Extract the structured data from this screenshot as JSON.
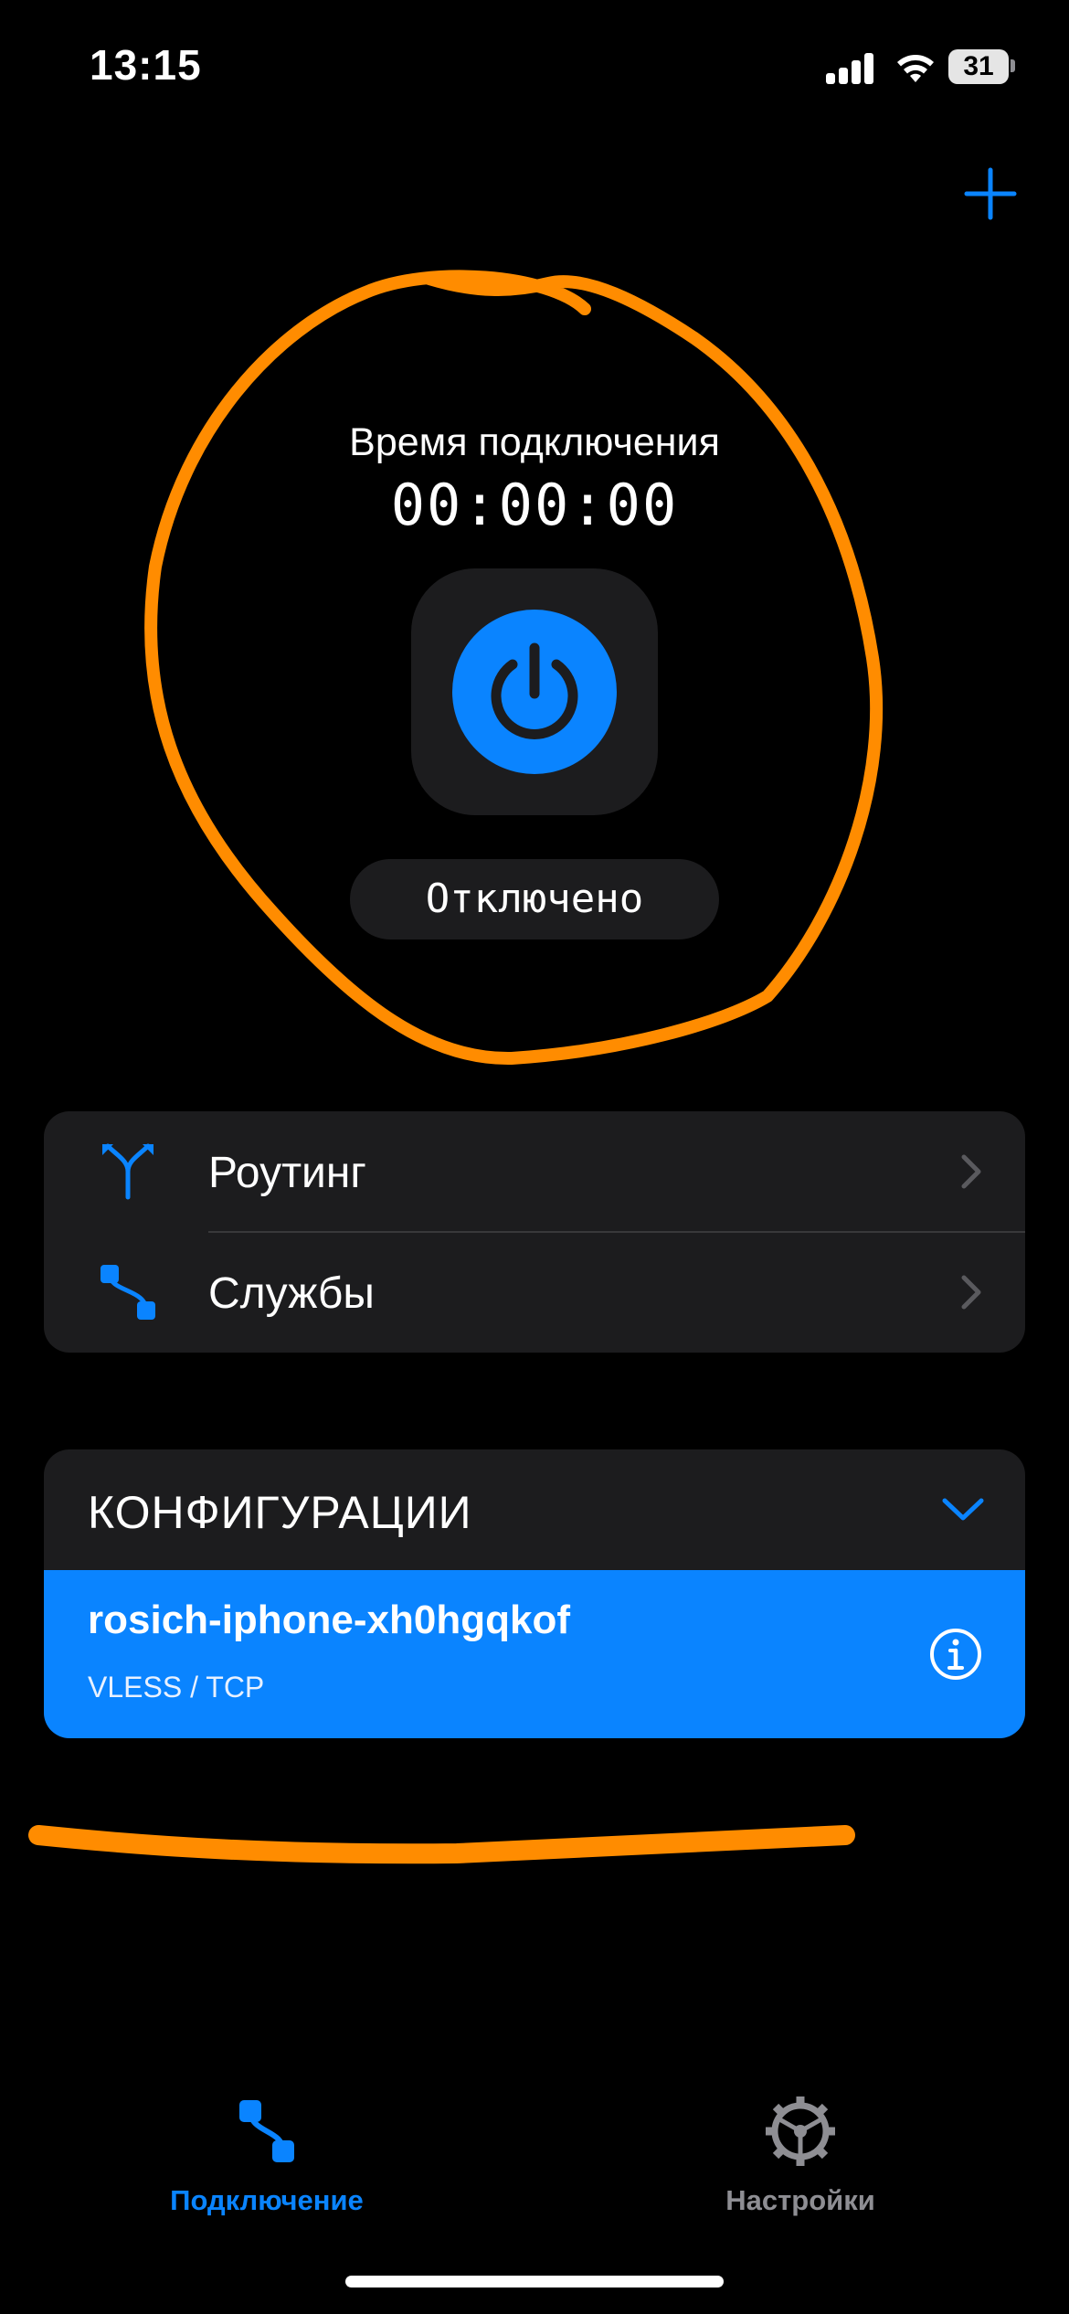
{
  "status_bar": {
    "time": "13:15",
    "battery": "31"
  },
  "header": {
    "add_icon": "plus-icon"
  },
  "connection": {
    "title": "Время подключения",
    "timer": "00:00:00",
    "power_icon": "power-icon",
    "status": "Отключено"
  },
  "menu": {
    "items": [
      {
        "label": "Роутинг",
        "icon": "routing-fork-icon"
      },
      {
        "label": "Службы",
        "icon": "services-path-icon"
      }
    ]
  },
  "configurations": {
    "title": "КОНФИГУРАЦИИ",
    "items": [
      {
        "name": "rosich-iphone-xh0hgqkof",
        "protocol": "VLESS / TCP",
        "selected": true
      }
    ]
  },
  "tab_bar": {
    "tabs": [
      {
        "label": "Подключение",
        "icon": "connection-path-icon",
        "active": true
      },
      {
        "label": "Настройки",
        "icon": "gear-icon",
        "active": false
      }
    ]
  },
  "colors": {
    "accent": "#0a84ff",
    "background": "#000000",
    "card": "#1c1c1e",
    "annotation": "#ff8c00"
  }
}
